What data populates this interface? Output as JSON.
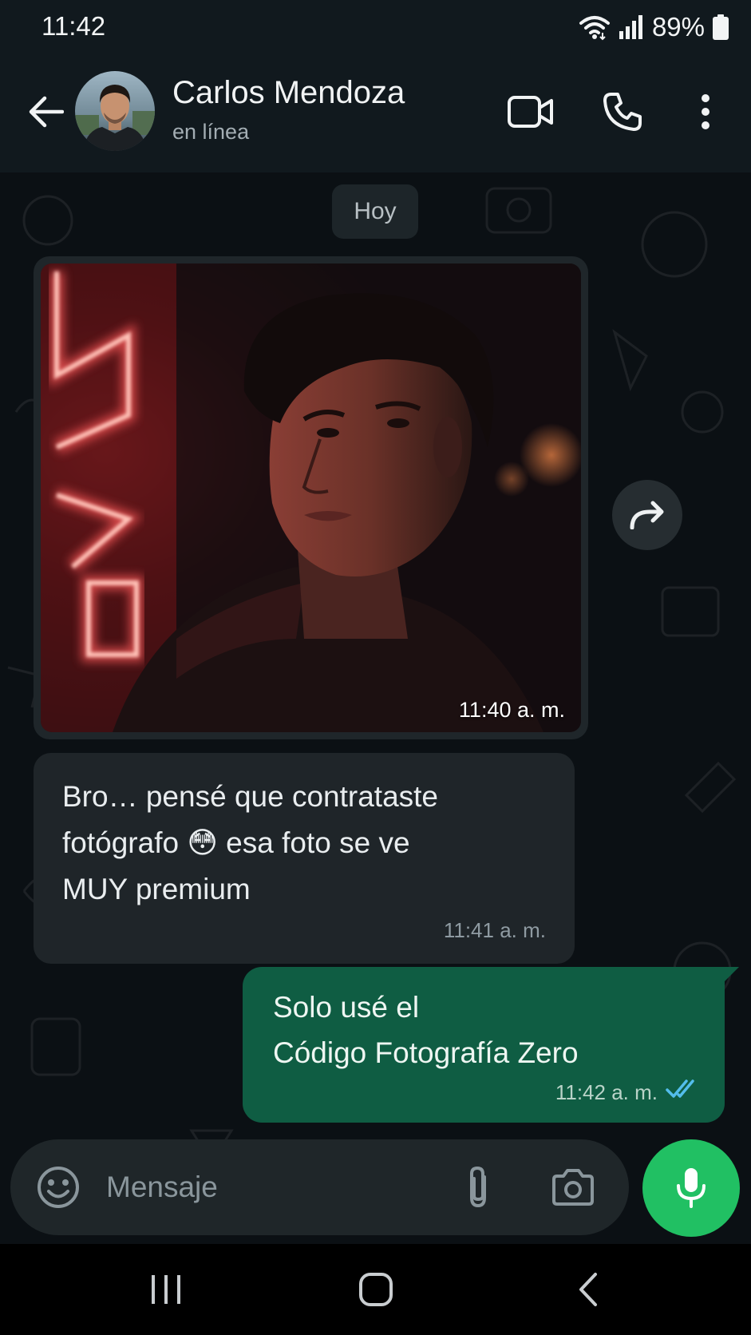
{
  "status_bar": {
    "time": "11:42",
    "battery": "89%",
    "icons": [
      "wifi-icon",
      "signal-icon",
      "battery-icon"
    ]
  },
  "header": {
    "contact_name": "Carlos Mendoza",
    "contact_status": "en línea",
    "icons": [
      "back-arrow-icon",
      "video-call-icon",
      "phone-icon",
      "more-vert-icon"
    ]
  },
  "chat": {
    "date_chip": "Hoy",
    "messages": [
      {
        "type": "image",
        "direction": "incoming",
        "time": "11:40 a. m."
      },
      {
        "type": "text",
        "direction": "incoming",
        "text": "Bro… pensé que contrataste\nfotógrafo 😳 esa foto se ve\nMUY premium",
        "time": "11:41 a. m."
      },
      {
        "type": "text",
        "direction": "outgoing",
        "text": "Solo usé el\nCódigo Fotografía Zero",
        "time": "11:42 a. m.",
        "status": "read"
      }
    ]
  },
  "composer": {
    "placeholder": "Mensaje",
    "icons": [
      "emoji-icon",
      "attach-icon",
      "camera-icon",
      "mic-icon"
    ]
  },
  "colors": {
    "background": "#0b1014",
    "header": "#11191e",
    "incoming_bubble": "#1f2529",
    "outgoing_bubble": "#0f5d43",
    "accent_green": "#21c063",
    "read_ticks": "#53bdeb"
  }
}
